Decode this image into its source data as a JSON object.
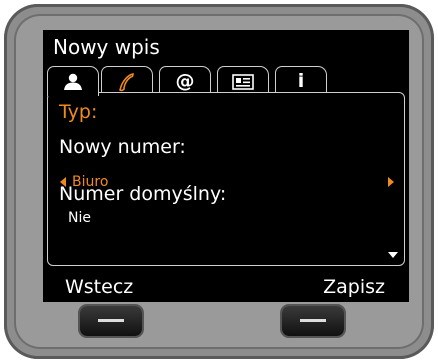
{
  "screen": {
    "title": "Nowy wpis",
    "tabs": [
      {
        "name": "contact-icon",
        "label": ""
      },
      {
        "name": "phone-icon",
        "label": ""
      },
      {
        "name": "email-icon",
        "label": "@"
      },
      {
        "name": "card-icon",
        "label": ""
      },
      {
        "name": "info-icon",
        "label": "i"
      }
    ],
    "fields": {
      "type_label": "Typ:",
      "type_value": "Biuro",
      "new_number_label": "Nowy numer:",
      "default_number_label": "Numer domyślny:",
      "default_number_value": "Nie"
    },
    "softkeys": {
      "left": "Wstecz",
      "right": "Zapisz"
    }
  },
  "colors": {
    "accent": "#f08a1e",
    "screen_bg": "#000000",
    "text": "#ffffff",
    "bezel": "#8d8d8d"
  }
}
